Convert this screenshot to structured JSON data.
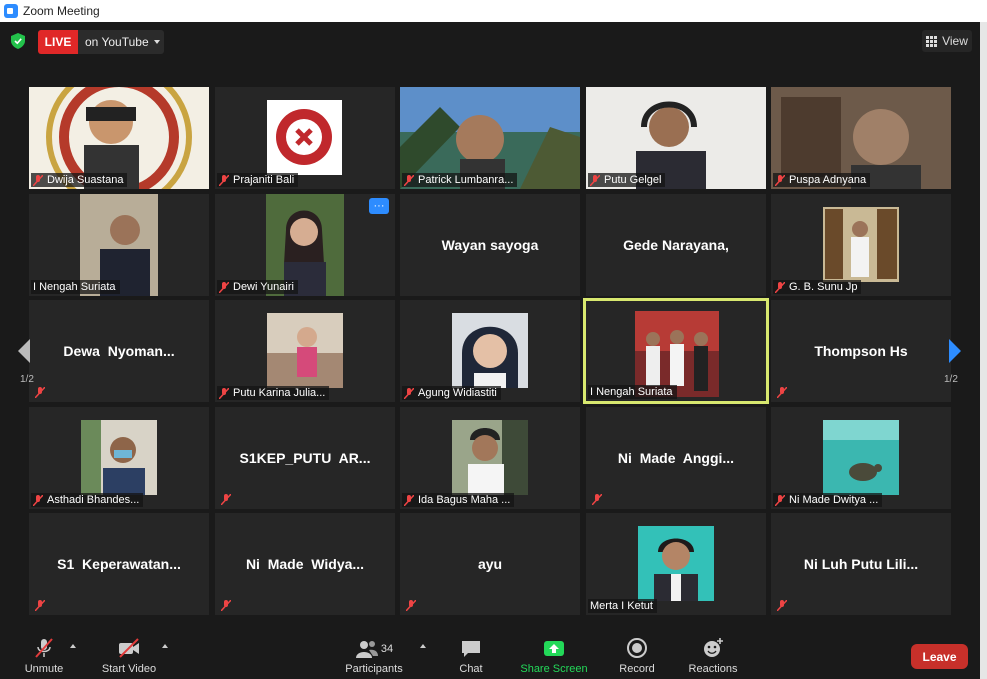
{
  "window": {
    "title": "Zoom Meeting"
  },
  "topbar": {
    "live_label": "LIVE",
    "live_destination": "on YouTube",
    "view_label": "View"
  },
  "pagination": {
    "left": "1/2",
    "right": "1/2"
  },
  "tiles": [
    {
      "name": "Dwija Suastana",
      "type": "video",
      "muted": true
    },
    {
      "name": "Prajaniti Bali",
      "type": "video",
      "muted": true
    },
    {
      "name": "Patrick Lumbanra...",
      "type": "video",
      "muted": true
    },
    {
      "name": "Putu Gelgel",
      "type": "video",
      "muted": true
    },
    {
      "name": "Puspa Adnyana",
      "type": "video",
      "muted": true
    },
    {
      "name": "I Nengah Suriata",
      "type": "video",
      "muted": false
    },
    {
      "name": "Dewi Yunairi",
      "type": "video",
      "muted": true
    },
    {
      "display": "Wayan sayoga",
      "type": "name"
    },
    {
      "display": "Gede Narayana,",
      "type": "name"
    },
    {
      "name": "G. B. Sunu Jp",
      "type": "video",
      "muted": true
    },
    {
      "display": "Dewa  Nyoman...",
      "type": "name",
      "muted": true
    },
    {
      "name": "Putu Karina Julia...",
      "type": "video",
      "muted": true
    },
    {
      "name": "Agung Widiastiti",
      "type": "video",
      "muted": true
    },
    {
      "name": "I Nengah Suriata",
      "type": "video",
      "muted": false,
      "active": true
    },
    {
      "display": "Thompson Hs",
      "type": "name",
      "muted": true
    },
    {
      "name": "Asthadi Bhandes...",
      "type": "video",
      "muted": true
    },
    {
      "display": "S1KEP_PUTU  AR...",
      "type": "name",
      "muted": true
    },
    {
      "name": "Ida Bagus Maha ...",
      "type": "video",
      "muted": true
    },
    {
      "display": "Ni  Made  Anggi...",
      "type": "name",
      "muted": true
    },
    {
      "name": "Ni Made Dwitya ...",
      "type": "video",
      "muted": true
    },
    {
      "display": "S1  Keperawatan...",
      "type": "name",
      "muted": true
    },
    {
      "display": "Ni  Made  Widya...",
      "type": "name",
      "muted": true
    },
    {
      "display": "ayu",
      "type": "name",
      "muted": true
    },
    {
      "name": "Merta I Ketut",
      "type": "video",
      "muted": false
    },
    {
      "display": "Ni Luh Putu Lili...",
      "type": "name",
      "muted": true
    }
  ],
  "more_button": "···",
  "toolbar": {
    "unmute": "Unmute",
    "start_video": "Start Video",
    "participants": "Participants",
    "participants_count": "34",
    "chat": "Chat",
    "share_screen": "Share Screen",
    "record": "Record",
    "reactions": "Reactions",
    "leave": "Leave"
  },
  "colors": {
    "live": "#e02828",
    "share": "#23d959",
    "leave": "#c7302a",
    "active_border": "#d8e86f",
    "more_button": "#2d8cff"
  }
}
